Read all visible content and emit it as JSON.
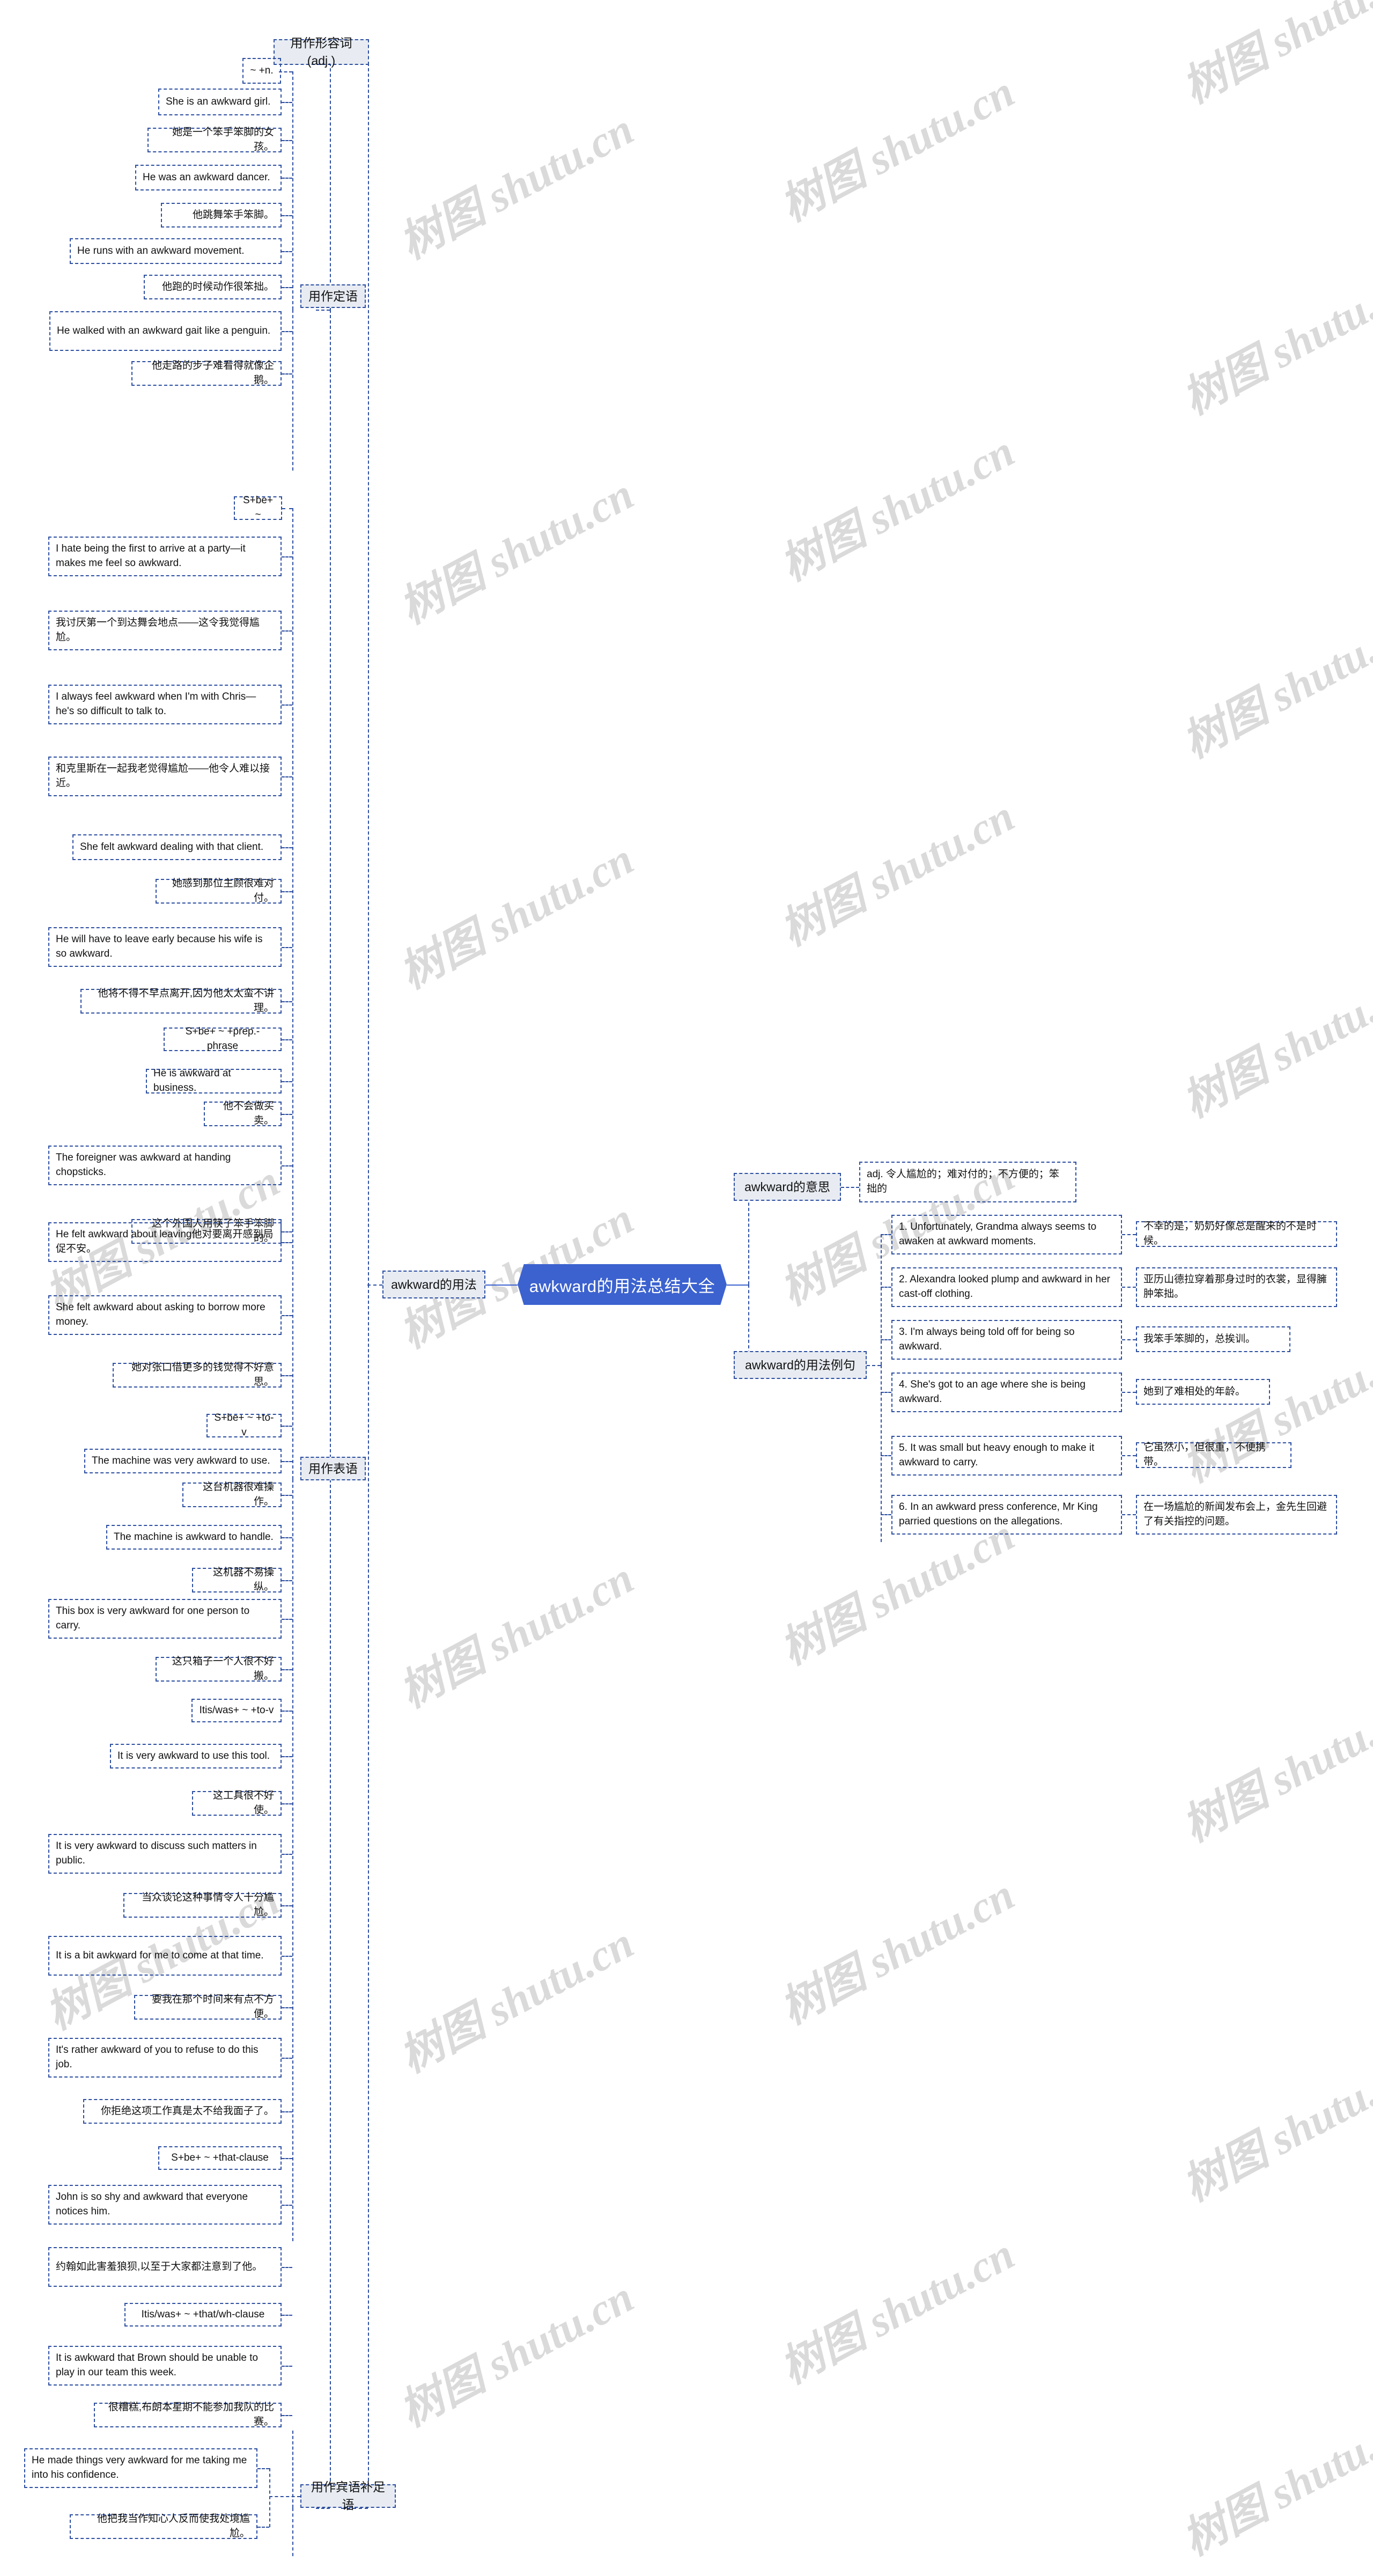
{
  "root": {
    "label": "awkward的用法总结大全"
  },
  "branches": {
    "left": {
      "label": "awkward的用法"
    },
    "meaning": {
      "label": "awkward的意思"
    },
    "examples": {
      "label": "awkward的用法例句"
    }
  },
  "meaning_detail": "adj. 令人尴尬的；难对付的；不方便的；笨拙的",
  "example_sentences": [
    {
      "en": "1. Unfortunately, Grandma always seems to awaken at awkward moments.",
      "cn": "不幸的是，奶奶好像总是醒来的不是时候。"
    },
    {
      "en": "2. Alexandra looked plump and awkward in her cast-off clothing.",
      "cn": "亚历山德拉穿着那身过时的衣裳，显得臃肿笨拙。"
    },
    {
      "en": "3. I'm always being told off for being so awkward.",
      "cn": "我笨手笨脚的，总挨训。"
    },
    {
      "en": "4. She's got to an age where she is being awkward.",
      "cn": "她到了难相处的年龄。"
    },
    {
      "en": "5. It was small but heavy enough to make it awkward to carry.",
      "cn": "它虽然小，但很重，不便携带。"
    },
    {
      "en": "6. In an awkward press conference, Mr King parried questions on the allegations.",
      "cn": "在一场尴尬的新闻发布会上，金先生回避了有关指控的问题。"
    }
  ],
  "usage_adj": {
    "label": "用作形容词(adj.)"
  },
  "usage_groups": [
    {
      "label": "用作定语"
    },
    {
      "label": "用作表语"
    },
    {
      "label": "用作宾语补足语"
    }
  ],
  "patterns": {
    "p1": "~ +n.",
    "p2": "S+be+ ~",
    "p3": "S+be+ ~ +prep.-phrase",
    "p4": "S+be+ ~ +to-v",
    "p5": "Itis/was+ ~ +to-v",
    "p6": "S+be+ ~ +that-clause",
    "p7": "Itis/was+ ~ +that/wh-clause"
  },
  "sentences": {
    "s1_en": "She is an awkward girl.",
    "s1_cn": "她是一个笨手笨脚的女孩。",
    "s2_en": "He was an awkward dancer.",
    "s2_cn": "他跳舞笨手笨脚。",
    "s3_en": "He runs with an awkward movement.",
    "s3_cn": "他跑的时候动作很笨拙。",
    "s4_en": "He walked with an awkward gait like a penguin.",
    "s4_cn": "他走路的步子难看得就像企鹅。",
    "s5_en": "I hate being the first to arrive at a party—it makes me feel so awkward.",
    "s5_cn": "我讨厌第一个到达舞会地点——这令我觉得尴尬。",
    "s6_en": "I always feel awkward when I'm with Chris—he's so difficult to talk to.",
    "s6_cn": "和克里斯在一起我老觉得尴尬——他令人难以接近。",
    "s7_en": "She felt awkward dealing with that client.",
    "s7_cn": "她感到那位主顾很难对付。",
    "s8_en": "He will have to leave early because his wife is so awkward.",
    "s8_cn": "他将不得不早点离开,因为他太太蛮不讲理。",
    "s9_en": "He is awkward at business.",
    "s9_cn": "他不会做买卖。",
    "s10_en": "The foreigner was awkward at handing chopsticks.",
    "s10_cn": "这个外国人用筷子笨手笨脚的。",
    "s11_en": "He felt awkward about leaving他对要离开感到局促不安。",
    "s12_en": "She felt awkward about asking to borrow more money.",
    "s12_cn": "她对张口借更多的钱觉得不好意思。",
    "s13_en": "The machine was very awkward to use.",
    "s13_cn": "这台机器很难操作。",
    "s14_en": "The machine is awkward to handle.",
    "s14_cn": "这机器不易操纵。",
    "s15_en": "This box is very awkward for one person to carry.",
    "s15_cn": "这只箱子一个人很不好搬。",
    "s16_en": "It is very awkward to use this tool.",
    "s16_cn": "这工具很不好使。",
    "s17_en": "It is very awkward to discuss such matters in public.",
    "s17_cn": "当众谈论这种事情令人十分尴尬。",
    "s18_en": "It is a bit awkward for me to come at that time.",
    "s18_cn": "要我在那个时间来有点不方便。",
    "s19_en": "It's rather awkward of you to refuse to do this job.",
    "s19_cn": "你拒绝这项工作真是太不给我面子了。",
    "s20_en": "John is so shy and awkward that everyone notices him.",
    "s20_cn": "约翰如此害羞狼狈,以至于大家都注意到了他。",
    "s21_en": "It is awkward that Brown should be unable to play in our team this week.",
    "s21_cn": "很糟糕,布朗本星期不能参加我队的比赛。",
    "s22_en": "He made things very awkward for me taking me into his confidence.",
    "s22_cn": "他把我当作知心人反而使我处境尴尬。"
  },
  "watermark": {
    "text": "树图 shutu.cn"
  },
  "colors": {
    "accent": "#3c62cf",
    "node_border": "#2d4fa2",
    "grey_fill": "#e8ecf2"
  }
}
